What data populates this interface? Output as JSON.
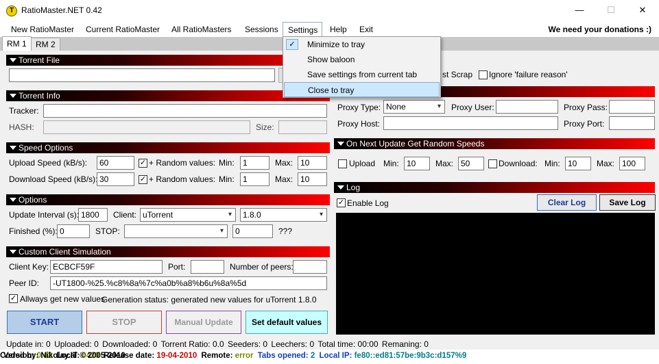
{
  "window": {
    "title": "RatioMaster.NET 0.42",
    "minimize_glyph": "—",
    "maximize_glyph": "☐",
    "close_glyph": "✕",
    "icon_glyph": "T"
  },
  "menu": {
    "items": [
      "New RatioMaster",
      "Current RatioMaster",
      "All RatioMasters",
      "Sessions",
      "Settings",
      "Help",
      "Exit"
    ],
    "donate": "We need your donations :)"
  },
  "tabs": [
    "RM 1",
    "RM 2"
  ],
  "settings_menu": {
    "items": [
      "Minimize to tray",
      "Show baloon",
      "Save settings from current tab",
      "Close to tray"
    ],
    "checked_glyph": "✓"
  },
  "torrent_file": {
    "header": "Torrent File",
    "path": ""
  },
  "torrent_info": {
    "header": "Torrent Info",
    "tracker_label": "Tracker:",
    "tracker": "",
    "hash_label": "HASH:",
    "hash": "",
    "size_label": "Size:",
    "size": ""
  },
  "scrape": {
    "partial_label": "st Scrap",
    "ignore_label": "Ignore 'failure reason'"
  },
  "proxy": {
    "type_label": "Proxy Type:",
    "type": "None",
    "user_label": "Proxy User:",
    "user": "",
    "pass_label": "Proxy Pass:",
    "pass": "",
    "host_label": "Proxy Host:",
    "host": "",
    "port_label": "Proxy Port:",
    "port": ""
  },
  "speed": {
    "header": "Speed Options",
    "upload_label": "Upload Speed (kB/s):",
    "upload": "60",
    "download_label": "Download Speed (kB/s):",
    "download": "30",
    "random_label": "+ Random values:",
    "min_label": "Min:",
    "max_label": "Max:",
    "up_min": "1",
    "up_max": "10",
    "down_min": "1",
    "down_max": "10"
  },
  "random_next": {
    "header": "On Next Update Get Random Speeds",
    "upload_label": "Upload",
    "download_label": "Download:",
    "min_label": "Min:",
    "max_label": "Max:",
    "up_min": "10",
    "up_max": "50",
    "down_min": "10",
    "down_max": "100"
  },
  "options": {
    "header": "Options",
    "interval_label": "Update Interval (s):",
    "interval": "1800",
    "client_label": "Client:",
    "client": "uTorrent",
    "version": "1.8.0",
    "finished_label": "Finished (%):",
    "finished": "0",
    "stop_label": "STOP:",
    "stop_type": "",
    "stop_value": "0",
    "unknown": "???"
  },
  "custom_client": {
    "header": "Custom Client Simulation",
    "key_label": "Client Key:",
    "key": "ECBCF59F",
    "port_label": "Port:",
    "port": "",
    "peers_label": "Number of peers:",
    "peers": "",
    "peer_id_label": "Peer ID:",
    "peer_id": "-UT1800-%25.%c8%8a%7c%a0b%a8%b6u%8a%5d",
    "always_new_label": "Allways get new values",
    "generation_status": "Generation status: generated new values for uTorrent 1.8.0"
  },
  "log": {
    "header": "Log",
    "enable_label": "Enable Log",
    "clear": "Clear Log",
    "save": "Save Log"
  },
  "buttons": {
    "start": "START",
    "stop": "STOP",
    "manual": "Manual Update",
    "defaults": "Set default values"
  },
  "status": {
    "update_in": "Update in:",
    "update_in_val": "0",
    "uploaded": "Uploaded:",
    "uploaded_val": "0",
    "downloaded": "Downloaded:",
    "downloaded_val": "0",
    "ratio": "Torrent Ratio:",
    "ratio_val": "0.0",
    "seeders": "Seeders:",
    "seeders_val": "0",
    "leechers": "Leechers:",
    "leechers_val": "0",
    "total_time": "Total time:",
    "total_time_val": "00:00",
    "remaining": "Remaning:",
    "remaining_val": "0"
  },
  "footer": {
    "version_label": "Version:",
    "version": "0.42",
    "local_label": "Local:",
    "local": "0420",
    "release_label": "Release date:",
    "release": "19-04-2010",
    "remote_label": "Remote:",
    "remote": "error",
    "tabs_label": "Tabs opened:",
    "tabs": "2",
    "ip_label": "Local IP:",
    "ip": "fe80::ed81:57be:9b3c:d157%9",
    "coded": "Coded by: Nikolay.IT © 2005-2010"
  },
  "colors": {
    "version": "#7a8a00",
    "release": "#d00000",
    "remote": "#7a8a00",
    "tabs": "#1040c0",
    "ip": "#007a8a"
  }
}
